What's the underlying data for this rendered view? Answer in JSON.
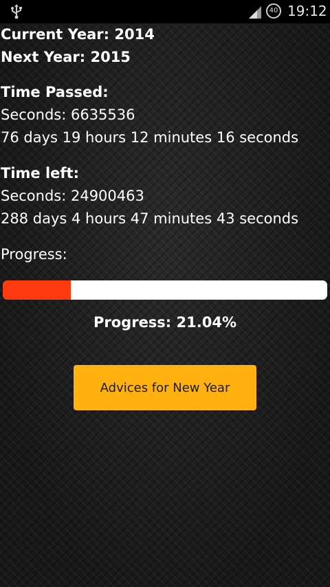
{
  "status_bar": {
    "time": "19:12",
    "alarm_badge": "40",
    "icons": [
      "usb-icon",
      "signal-icon",
      "alarm-icon"
    ]
  },
  "year": {
    "current": "Current Year: 2014",
    "next": "Next Year: 2015"
  },
  "passed": {
    "heading": "Time Passed:",
    "seconds": "Seconds: 6635536",
    "breakdown": "76 days 19 hours 12 minutes 16 seconds"
  },
  "left": {
    "heading": "Time left:",
    "seconds": "Seconds: 24900463",
    "breakdown": "288 days 4 hours 47 minutes 43 seconds"
  },
  "progress": {
    "label": "Progress:",
    "value_percent": 21.04,
    "text": "Progress: 21.04%"
  },
  "button": {
    "label": "Advices for New Year"
  },
  "colors": {
    "progress_fill": "#ff3a0e",
    "button": "#ffb20f"
  }
}
